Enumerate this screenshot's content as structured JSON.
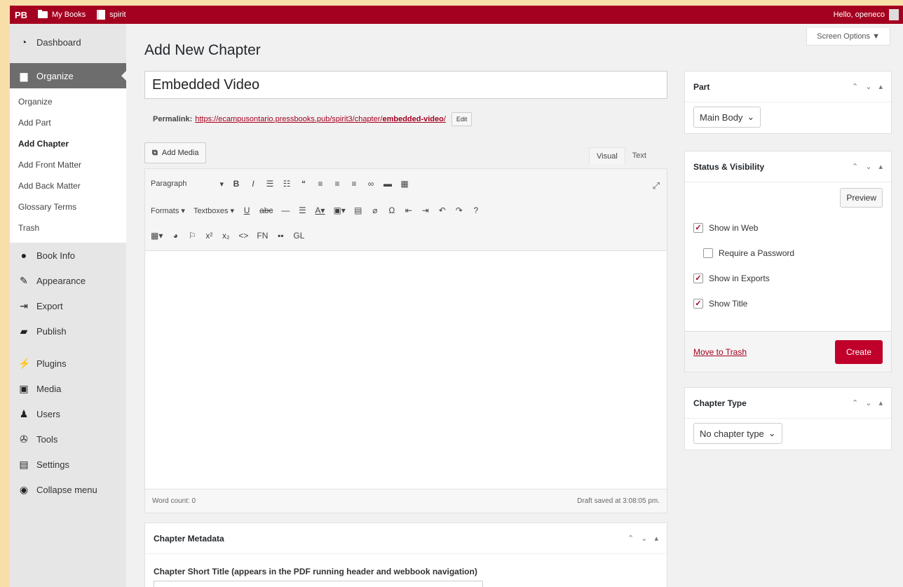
{
  "adminbar": {
    "logo": "PB",
    "my_books": "My Books",
    "book_name": "spirit",
    "greeting": "Hello, openeco"
  },
  "sidebar": {
    "top": [
      {
        "label": "Dashboard",
        "icon": "dashboard-icon"
      }
    ],
    "active": {
      "label": "Organize",
      "icon": "organize-icon"
    },
    "submenu": [
      "Organize",
      "Add Part",
      "Add Chapter",
      "Add Front Matter",
      "Add Back Matter",
      "Glossary Terms",
      "Trash"
    ],
    "submenu_current": "Add Chapter",
    "items": [
      {
        "label": "Book Info",
        "icon": "info-icon"
      },
      {
        "label": "Appearance",
        "icon": "appearance-icon"
      },
      {
        "label": "Export",
        "icon": "export-icon"
      },
      {
        "label": "Publish",
        "icon": "publish-icon"
      },
      {
        "label": "Plugins",
        "icon": "plugins-icon"
      },
      {
        "label": "Media",
        "icon": "media-icon"
      },
      {
        "label": "Users",
        "icon": "users-icon"
      },
      {
        "label": "Tools",
        "icon": "tools-icon"
      },
      {
        "label": "Settings",
        "icon": "settings-icon"
      },
      {
        "label": "Collapse menu",
        "icon": "collapse-icon"
      }
    ]
  },
  "screen_options": "Screen Options ▼",
  "page_title": "Add New Chapter",
  "title_value": "Embedded Video",
  "permalink": {
    "label": "Permalink:",
    "url_base": "https://ecampusontario.pressbooks.pub/spirit3/chapter/",
    "slug": "embedded-video",
    "trail": "/",
    "edit": "Edit"
  },
  "editor": {
    "add_media": "Add Media",
    "tab_visual": "Visual",
    "tab_text": "Text",
    "format_select": "Paragraph",
    "formats": "Formats",
    "textboxes": "Textboxes",
    "fn": "FN",
    "gl": "GL",
    "word_count": "Word count: 0",
    "draft_saved": "Draft saved at 3:08:05 pm."
  },
  "metadata": {
    "title": "Chapter Metadata",
    "short_title_label": "Chapter Short Title (appears in the PDF running header and webbook navigation)"
  },
  "part_box": {
    "title": "Part",
    "selected": "Main Body"
  },
  "status_box": {
    "title": "Status & Visibility",
    "preview": "Preview",
    "show_web": "Show in Web",
    "require_password": "Require a Password",
    "show_exports": "Show in Exports",
    "show_title": "Show Title",
    "move_to_trash": "Move to Trash",
    "create": "Create"
  },
  "chapter_type_box": {
    "title": "Chapter Type",
    "selected": "No chapter type"
  },
  "colors": {
    "brand": "#a4001f",
    "create_button": "#c0002a",
    "sidebar_active": "#6d6d6d"
  }
}
